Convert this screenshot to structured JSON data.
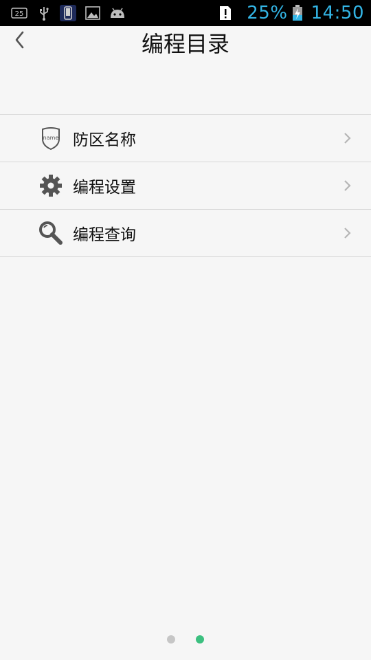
{
  "status_bar": {
    "notification_badge": "25",
    "battery_percent": "25%",
    "time": "14:50",
    "icons": [
      "notification-count-icon",
      "usb-icon",
      "phone-icon",
      "image-icon",
      "android-icon",
      "alert-icon",
      "battery-charging-icon"
    ]
  },
  "header": {
    "title": "编程目录",
    "back_icon": "chevron-left-icon"
  },
  "menu": {
    "items": [
      {
        "label": "防区名称",
        "icon": "shield-name-icon",
        "icon_text": "name"
      },
      {
        "label": "编程设置",
        "icon": "gear-icon"
      },
      {
        "label": "编程查询",
        "icon": "search-icon"
      }
    ]
  },
  "pager": {
    "count": 2,
    "active_index": 1,
    "colors": {
      "inactive": "#c6c6c6",
      "active": "#3cc080"
    }
  },
  "colors": {
    "status_accent": "#33b5e5",
    "background": "#f6f6f6"
  }
}
